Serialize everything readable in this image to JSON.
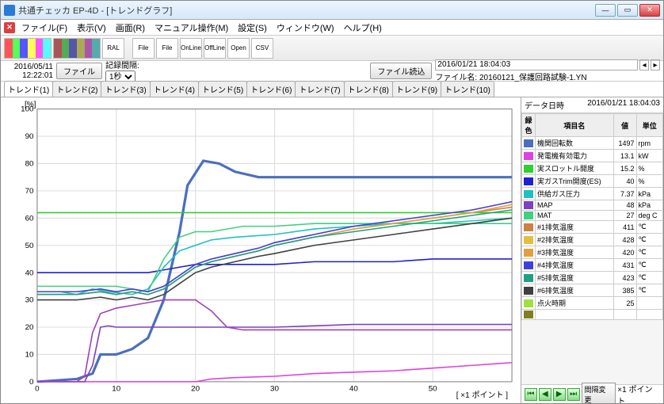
{
  "window": {
    "title": "共通チェッカ EP-4D - [トレンドグラフ]"
  },
  "menu": {
    "items": [
      "ファイル(F)",
      "表示(V)",
      "画面(R)",
      "マニュアル操作(M)",
      "設定(S)",
      "ウィンドウ(W)",
      "ヘルプ(H)"
    ]
  },
  "toolbar": {
    "ral": "RAL",
    "file": "File",
    "online": "OnLine",
    "offline": "OffLine",
    "open": "Open",
    "csv": "CSV"
  },
  "info": {
    "datetime_line1": "2016/05/11",
    "datetime_line2": "12:22:01",
    "file_btn": "ファイル",
    "interval_label": "記録間隔:",
    "interval_value": "1秒",
    "load_btn": "ファイル読込",
    "timestamp": "2016/01/21 18:04:03",
    "file_name": "ファイル名: 20160121_保護回路試験-1.YN"
  },
  "tabs": [
    "トレンド(1)",
    "トレンド(2)",
    "トレンド(3)",
    "トレンド(4)",
    "トレンド(5)",
    "トレンド(6)",
    "トレンド(7)",
    "トレンド(8)",
    "トレンド(9)",
    "トレンド(10)"
  ],
  "sidebar": {
    "head_label": "データ日時",
    "head_value": "2016/01/21 18:04:03",
    "cols": [
      "緑色",
      "項目名",
      "値",
      "単位"
    ],
    "rows": [
      {
        "color": "#4a6fbf",
        "name": "機関回転数",
        "value": "1497",
        "unit": "rpm"
      },
      {
        "color": "#e040e0",
        "name": "発電機有効電力",
        "value": "13.1",
        "unit": "kW"
      },
      {
        "color": "#30d030",
        "name": "実スロットル開度",
        "value": "15.2",
        "unit": "%"
      },
      {
        "color": "#2020d0",
        "name": "実ガスTrim開度(ES)",
        "value": "40",
        "unit": "%"
      },
      {
        "color": "#20c0c0",
        "name": "供給ガス圧力",
        "value": "7.37",
        "unit": "kPa"
      },
      {
        "color": "#8040c0",
        "name": "MAP",
        "value": "48",
        "unit": "kPa"
      },
      {
        "color": "#40d080",
        "name": "MAT",
        "value": "27",
        "unit": "deg C"
      },
      {
        "color": "#d08040",
        "name": "#1排気温度",
        "value": "411",
        "unit": "℃"
      },
      {
        "color": "#e0c040",
        "name": "#2排気温度",
        "value": "428",
        "unit": "℃"
      },
      {
        "color": "#e0a040",
        "name": "#3排気温度",
        "value": "420",
        "unit": "℃"
      },
      {
        "color": "#4040e0",
        "name": "#4排気温度",
        "value": "431",
        "unit": "℃"
      },
      {
        "color": "#20a080",
        "name": "#5排気温度",
        "value": "423",
        "unit": "℃"
      },
      {
        "color": "#404040",
        "name": "#6排気温度",
        "value": "385",
        "unit": "℃"
      },
      {
        "color": "#a0e040",
        "name": "点火時期",
        "value": "25",
        "unit": ""
      },
      {
        "color": "#808020",
        "name": "",
        "value": "",
        "unit": ""
      }
    ]
  },
  "footer": {
    "range_btn": "間隔変更",
    "unit_label": "×1 ポイント"
  },
  "chart": {
    "ylabel": "[%]",
    "xlabel": "[ ×1 ポイント ]"
  },
  "chart_data": {
    "type": "line",
    "xlim": [
      0,
      60
    ],
    "ylim": [
      0,
      100
    ],
    "xticks": [
      0,
      10,
      20,
      30,
      40,
      50
    ],
    "yticks": [
      0,
      10,
      20,
      30,
      40,
      50,
      60,
      70,
      80,
      90,
      100
    ],
    "ylabel": "[%]",
    "xlabel": "×1 ポイント",
    "series": [
      {
        "name": "機関回転数",
        "color": "#4a6fbf",
        "width": 3,
        "points": [
          [
            0,
            0
          ],
          [
            5,
            1
          ],
          [
            7,
            3
          ],
          [
            8,
            10
          ],
          [
            10,
            10
          ],
          [
            12,
            12
          ],
          [
            14,
            16
          ],
          [
            16,
            30
          ],
          [
            18,
            55
          ],
          [
            19,
            72
          ],
          [
            21,
            81
          ],
          [
            23,
            80
          ],
          [
            25,
            77
          ],
          [
            28,
            75
          ],
          [
            35,
            75
          ],
          [
            45,
            75
          ],
          [
            55,
            75
          ],
          [
            60,
            75
          ]
        ]
      },
      {
        "name": "発電機有効電力",
        "color": "#e040e0",
        "points": [
          [
            0,
            0
          ],
          [
            8,
            0
          ],
          [
            10,
            0
          ],
          [
            15,
            0
          ],
          [
            20,
            0
          ],
          [
            22,
            1
          ],
          [
            25,
            1.5
          ],
          [
            30,
            2
          ],
          [
            35,
            3
          ],
          [
            40,
            3.5
          ],
          [
            45,
            4
          ],
          [
            50,
            5
          ],
          [
            55,
            6
          ],
          [
            60,
            7
          ]
        ]
      },
      {
        "name": "実スロットル開度",
        "color": "#30d030",
        "points": [
          [
            0,
            62
          ],
          [
            10,
            62
          ],
          [
            20,
            62
          ],
          [
            30,
            62
          ],
          [
            40,
            62
          ],
          [
            50,
            62
          ],
          [
            60,
            62
          ]
        ]
      },
      {
        "name": "実ガスTrim開度",
        "color": "#2020d0",
        "points": [
          [
            0,
            40
          ],
          [
            10,
            40
          ],
          [
            14,
            40
          ],
          [
            16,
            41
          ],
          [
            18,
            42
          ],
          [
            20,
            43
          ],
          [
            25,
            43
          ],
          [
            30,
            43
          ],
          [
            35,
            44
          ],
          [
            40,
            44
          ],
          [
            45,
            44
          ],
          [
            50,
            45
          ],
          [
            55,
            45
          ],
          [
            60,
            45
          ]
        ]
      },
      {
        "name": "供給ガス圧力",
        "color": "#20c0c0",
        "points": [
          [
            0,
            33
          ],
          [
            3,
            33
          ],
          [
            5,
            32
          ],
          [
            7,
            34
          ],
          [
            9,
            33
          ],
          [
            12,
            32
          ],
          [
            14,
            34
          ],
          [
            16,
            42
          ],
          [
            18,
            48
          ],
          [
            20,
            50
          ],
          [
            22,
            52
          ],
          [
            25,
            53
          ],
          [
            30,
            54
          ],
          [
            35,
            56
          ],
          [
            40,
            57
          ],
          [
            45,
            58
          ],
          [
            50,
            58
          ],
          [
            55,
            59
          ],
          [
            60,
            60
          ]
        ]
      },
      {
        "name": "MAP",
        "color": "#8040c0",
        "points": [
          [
            0,
            0
          ],
          [
            6,
            0
          ],
          [
            7,
            6
          ],
          [
            8,
            20
          ],
          [
            9,
            20.5
          ],
          [
            10,
            20
          ],
          [
            15,
            20
          ],
          [
            20,
            20
          ],
          [
            25,
            20
          ],
          [
            30,
            20
          ],
          [
            35,
            20.5
          ],
          [
            40,
            21
          ],
          [
            50,
            21
          ],
          [
            60,
            21
          ]
        ]
      },
      {
        "name": "MAT",
        "color": "#40d080",
        "points": [
          [
            0,
            35
          ],
          [
            5,
            35
          ],
          [
            10,
            35
          ],
          [
            12,
            34
          ],
          [
            14,
            33
          ],
          [
            16,
            45
          ],
          [
            18,
            53
          ],
          [
            20,
            55
          ],
          [
            22,
            55
          ],
          [
            24,
            56
          ],
          [
            26,
            57
          ],
          [
            30,
            57
          ],
          [
            35,
            58
          ],
          [
            40,
            58
          ],
          [
            50,
            58
          ],
          [
            60,
            58
          ]
        ]
      },
      {
        "name": "#1排気温度",
        "color": "#d08040",
        "points": [
          [
            0,
            32
          ],
          [
            5,
            32
          ],
          [
            8,
            33
          ],
          [
            10,
            32
          ],
          [
            12,
            33
          ],
          [
            14,
            32
          ],
          [
            16,
            34
          ],
          [
            18,
            38
          ],
          [
            20,
            42
          ],
          [
            22,
            44
          ],
          [
            25,
            46
          ],
          [
            28,
            48
          ],
          [
            30,
            50
          ],
          [
            35,
            53
          ],
          [
            40,
            56
          ],
          [
            45,
            58
          ],
          [
            50,
            60
          ],
          [
            55,
            62
          ],
          [
            60,
            64
          ]
        ]
      },
      {
        "name": "#2排気温度",
        "color": "#e0c040",
        "points": [
          [
            0,
            33
          ],
          [
            5,
            33
          ],
          [
            8,
            34
          ],
          [
            10,
            33
          ],
          [
            12,
            34
          ],
          [
            14,
            33
          ],
          [
            16,
            35
          ],
          [
            18,
            39
          ],
          [
            20,
            43
          ],
          [
            22,
            45
          ],
          [
            25,
            47
          ],
          [
            28,
            49
          ],
          [
            30,
            51
          ],
          [
            35,
            54
          ],
          [
            40,
            57
          ],
          [
            45,
            59
          ],
          [
            50,
            61
          ],
          [
            55,
            63
          ],
          [
            60,
            66
          ]
        ]
      },
      {
        "name": "#3排気温度",
        "color": "#e0a040",
        "points": [
          [
            0,
            32
          ],
          [
            5,
            32
          ],
          [
            8,
            33
          ],
          [
            10,
            32
          ],
          [
            12,
            33
          ],
          [
            14,
            32
          ],
          [
            16,
            34
          ],
          [
            18,
            38
          ],
          [
            20,
            42
          ],
          [
            22,
            44
          ],
          [
            25,
            46
          ],
          [
            28,
            48
          ],
          [
            30,
            50
          ],
          [
            35,
            53
          ],
          [
            40,
            56
          ],
          [
            45,
            58
          ],
          [
            50,
            60
          ],
          [
            55,
            62
          ],
          [
            60,
            65
          ]
        ]
      },
      {
        "name": "#4排気温度",
        "color": "#4040e0",
        "points": [
          [
            0,
            33
          ],
          [
            5,
            33
          ],
          [
            8,
            34
          ],
          [
            10,
            33
          ],
          [
            12,
            34
          ],
          [
            14,
            33
          ],
          [
            16,
            35
          ],
          [
            18,
            39
          ],
          [
            20,
            43
          ],
          [
            22,
            45
          ],
          [
            25,
            47
          ],
          [
            28,
            49
          ],
          [
            30,
            51
          ],
          [
            35,
            54
          ],
          [
            40,
            57
          ],
          [
            45,
            59
          ],
          [
            50,
            61
          ],
          [
            55,
            63
          ],
          [
            60,
            66
          ]
        ]
      },
      {
        "name": "#5排気温度",
        "color": "#20a080",
        "points": [
          [
            0,
            32
          ],
          [
            5,
            32
          ],
          [
            8,
            33
          ],
          [
            10,
            32
          ],
          [
            12,
            33
          ],
          [
            14,
            32
          ],
          [
            16,
            34
          ],
          [
            18,
            38
          ],
          [
            20,
            42
          ],
          [
            22,
            44
          ],
          [
            25,
            46
          ],
          [
            28,
            48
          ],
          [
            30,
            50
          ],
          [
            35,
            53
          ],
          [
            40,
            55
          ],
          [
            45,
            57
          ],
          [
            50,
            59
          ],
          [
            55,
            61
          ],
          [
            60,
            63
          ]
        ]
      },
      {
        "name": "#6排気温度",
        "color": "#404040",
        "points": [
          [
            0,
            30
          ],
          [
            5,
            30
          ],
          [
            8,
            31
          ],
          [
            10,
            30
          ],
          [
            12,
            31
          ],
          [
            14,
            30
          ],
          [
            16,
            32
          ],
          [
            18,
            36
          ],
          [
            20,
            40
          ],
          [
            22,
            42
          ],
          [
            25,
            44
          ],
          [
            28,
            46
          ],
          [
            30,
            47
          ],
          [
            35,
            50
          ],
          [
            40,
            52
          ],
          [
            45,
            54
          ],
          [
            50,
            56
          ],
          [
            55,
            58
          ],
          [
            60,
            60
          ]
        ]
      },
      {
        "name": "点火時期",
        "color": "#a040c0",
        "points": [
          [
            0,
            0
          ],
          [
            5,
            0
          ],
          [
            6,
            2
          ],
          [
            7,
            18
          ],
          [
            8,
            25
          ],
          [
            9,
            26
          ],
          [
            10,
            27
          ],
          [
            12,
            28
          ],
          [
            14,
            29
          ],
          [
            16,
            30
          ],
          [
            18,
            30
          ],
          [
            20,
            30
          ],
          [
            22,
            26
          ],
          [
            24,
            20
          ],
          [
            26,
            19
          ],
          [
            28,
            19
          ],
          [
            30,
            19
          ],
          [
            35,
            19
          ],
          [
            40,
            19
          ],
          [
            45,
            19
          ],
          [
            50,
            19
          ],
          [
            55,
            19
          ],
          [
            60,
            19
          ]
        ]
      }
    ]
  }
}
